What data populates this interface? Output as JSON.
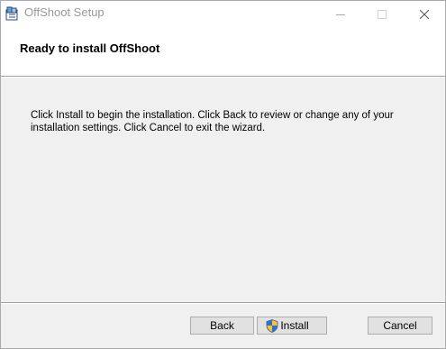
{
  "window": {
    "title": "OffShoot Setup",
    "app_icon": "installer-package-icon",
    "controls": {
      "minimize_icon": "minimize-icon",
      "maximize_icon": "maximize-icon",
      "close_icon": "close-icon"
    }
  },
  "header": {
    "title": "Ready to install OffShoot"
  },
  "body": {
    "message": "Click Install to begin the installation. Click Back to review or change any of your installation settings. Click Cancel to exit the wizard."
  },
  "buttons": {
    "back_label": "Back",
    "install_label": "Install",
    "install_icon": "uac-shield-icon",
    "cancel_label": "Cancel"
  },
  "colors": {
    "dialog_background": "#f0f0f0",
    "header_background": "#ffffff",
    "title_text": "#999999",
    "button_face": "#e1e1e1",
    "button_border": "#adadad"
  }
}
